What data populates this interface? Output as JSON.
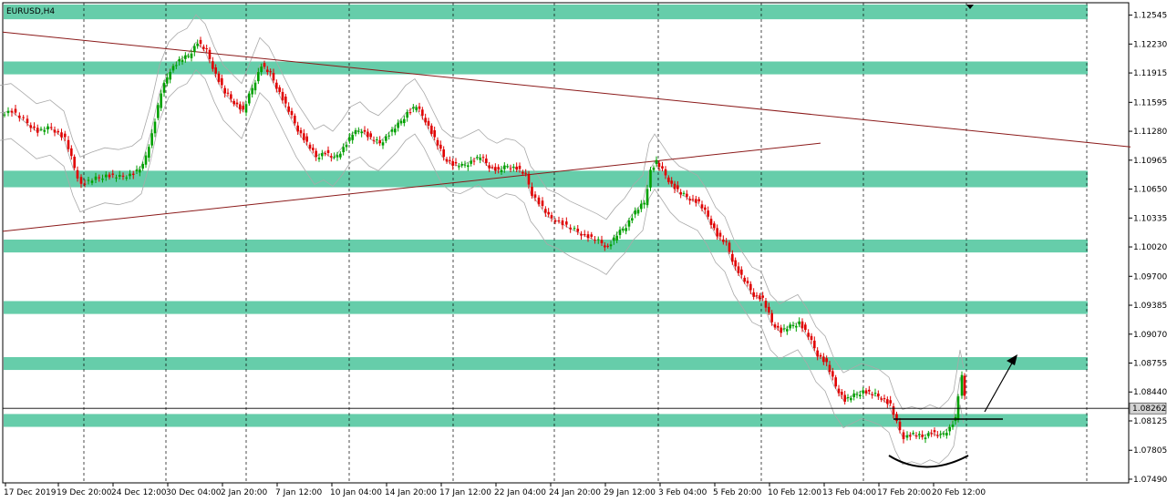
{
  "chart_data": {
    "type": "candlestick",
    "title": "EURUSD,H4",
    "y_ticks": [
      "1.12545",
      "1.12230",
      "1.11915",
      "1.11595",
      "1.11280",
      "1.10965",
      "1.10650",
      "1.10335",
      "1.10020",
      "1.09700",
      "1.09385",
      "1.09070",
      "1.08755",
      "1.08440",
      "1.08125",
      "1.07805",
      "1.07490"
    ],
    "ylim": [
      1.0745,
      1.1268
    ],
    "current_price": "1.08262",
    "x_ticks": [
      "17 Dec 2019",
      "19 Dec 20:00",
      "24 Dec 12:00",
      "30 Dec 04:00",
      "2 Jan 20:00",
      "7 Jan 12:00",
      "10 Jan 04:00",
      "14 Jan 20:00",
      "17 Jan 12:00",
      "22 Jan 04:00",
      "24 Jan 20:00",
      "29 Jan 12:00",
      "3 Feb 04:00",
      "5 Feb 20:00",
      "10 Feb 12:00",
      "13 Feb 04:00",
      "17 Feb 20:00",
      "20 Feb 12:00"
    ],
    "grid": true,
    "colors": {
      "bull": "#00a000",
      "bear": "#e00000",
      "zone": "#66cdaa",
      "trendline": "#8b1a1a",
      "band": "#a9a9a9",
      "grid": "#000000"
    },
    "zones": [
      {
        "low": 1.125,
        "high": 1.1266
      },
      {
        "low": 1.119,
        "high": 1.1204
      },
      {
        "low": 1.1067,
        "high": 1.1085
      },
      {
        "low": 1.0996,
        "high": 1.101
      },
      {
        "low": 1.0929,
        "high": 1.0943
      },
      {
        "low": 1.0868,
        "high": 1.0882
      },
      {
        "low": 1.0806,
        "high": 1.082
      }
    ],
    "trendlines": [
      {
        "x1": 0,
        "y1": 1.1236,
        "x2": 1240,
        "y2": 1.1111
      },
      {
        "x1": 0,
        "y1": 1.1019,
        "x2": 900,
        "y2": 1.1115
      }
    ],
    "series_path": [
      [
        0,
        1.1148
      ],
      [
        12,
        1.115
      ],
      [
        25,
        1.114
      ],
      [
        40,
        1.1128
      ],
      [
        55,
        1.1132
      ],
      [
        70,
        1.112
      ],
      [
        80,
        1.1088
      ],
      [
        88,
        1.107
      ],
      [
        100,
        1.1075
      ],
      [
        115,
        1.108
      ],
      [
        130,
        1.1078
      ],
      [
        145,
        1.1082
      ],
      [
        155,
        1.109
      ],
      [
        165,
        1.1125
      ],
      [
        175,
        1.117
      ],
      [
        185,
        1.1195
      ],
      [
        195,
        1.1205
      ],
      [
        205,
        1.121
      ],
      [
        215,
        1.1225
      ],
      [
        225,
        1.1215
      ],
      [
        235,
        1.119
      ],
      [
        245,
        1.117
      ],
      [
        255,
        1.116
      ],
      [
        265,
        1.115
      ],
      [
        275,
        1.1175
      ],
      [
        285,
        1.12
      ],
      [
        295,
        1.119
      ],
      [
        305,
        1.117
      ],
      [
        315,
        1.115
      ],
      [
        325,
        1.113
      ],
      [
        335,
        1.1115
      ],
      [
        345,
        1.11
      ],
      [
        355,
        1.1105
      ],
      [
        365,
        1.1098
      ],
      [
        375,
        1.111
      ],
      [
        385,
        1.1125
      ],
      [
        395,
        1.113
      ],
      [
        405,
        1.112
      ],
      [
        415,
        1.1115
      ],
      [
        425,
        1.1125
      ],
      [
        435,
        1.1135
      ],
      [
        445,
        1.1148
      ],
      [
        455,
        1.1155
      ],
      [
        465,
        1.114
      ],
      [
        475,
        1.112
      ],
      [
        485,
        1.11
      ],
      [
        495,
        1.1092
      ],
      [
        505,
        1.109
      ],
      [
        515,
        1.1095
      ],
      [
        525,
        1.11
      ],
      [
        535,
        1.109
      ],
      [
        545,
        1.1085
      ],
      [
        555,
        1.109
      ],
      [
        565,
        1.1088
      ],
      [
        575,
        1.108
      ],
      [
        582,
        1.106
      ],
      [
        590,
        1.105
      ],
      [
        600,
        1.1035
      ],
      [
        612,
        1.103
      ],
      [
        625,
        1.1022
      ],
      [
        640,
        1.1015
      ],
      [
        655,
        1.1008
      ],
      [
        665,
        1.1002
      ],
      [
        675,
        1.1015
      ],
      [
        685,
        1.1025
      ],
      [
        695,
        1.104
      ],
      [
        705,
        1.105
      ],
      [
        712,
        1.1085
      ],
      [
        718,
        1.1095
      ],
      [
        725,
        1.1085
      ],
      [
        735,
        1.107
      ],
      [
        745,
        1.106
      ],
      [
        755,
        1.1055
      ],
      [
        765,
        1.105
      ],
      [
        775,
        1.1035
      ],
      [
        785,
        1.1015
      ],
      [
        795,
        1.1005
      ],
      [
        805,
        1.098
      ],
      [
        815,
        1.0965
      ],
      [
        825,
        1.095
      ],
      [
        835,
        1.0945
      ],
      [
        845,
        1.092
      ],
      [
        855,
        1.091
      ],
      [
        865,
        1.0915
      ],
      [
        875,
        1.092
      ],
      [
        885,
        1.0905
      ],
      [
        895,
        1.0885
      ],
      [
        905,
        1.0875
      ],
      [
        915,
        1.085
      ],
      [
        925,
        1.0835
      ],
      [
        935,
        1.084
      ],
      [
        945,
        1.0845
      ],
      [
        955,
        1.0842
      ],
      [
        965,
        1.0838
      ],
      [
        975,
        1.083
      ],
      [
        982,
        1.081
      ],
      [
        990,
        1.0795
      ],
      [
        1000,
        1.0798
      ],
      [
        1010,
        1.0795
      ],
      [
        1020,
        1.08
      ],
      [
        1030,
        1.0796
      ],
      [
        1040,
        1.0805
      ],
      [
        1046,
        1.0815
      ],
      [
        1050,
        1.084
      ],
      [
        1053,
        1.086
      ],
      [
        1057,
        1.084
      ]
    ]
  }
}
